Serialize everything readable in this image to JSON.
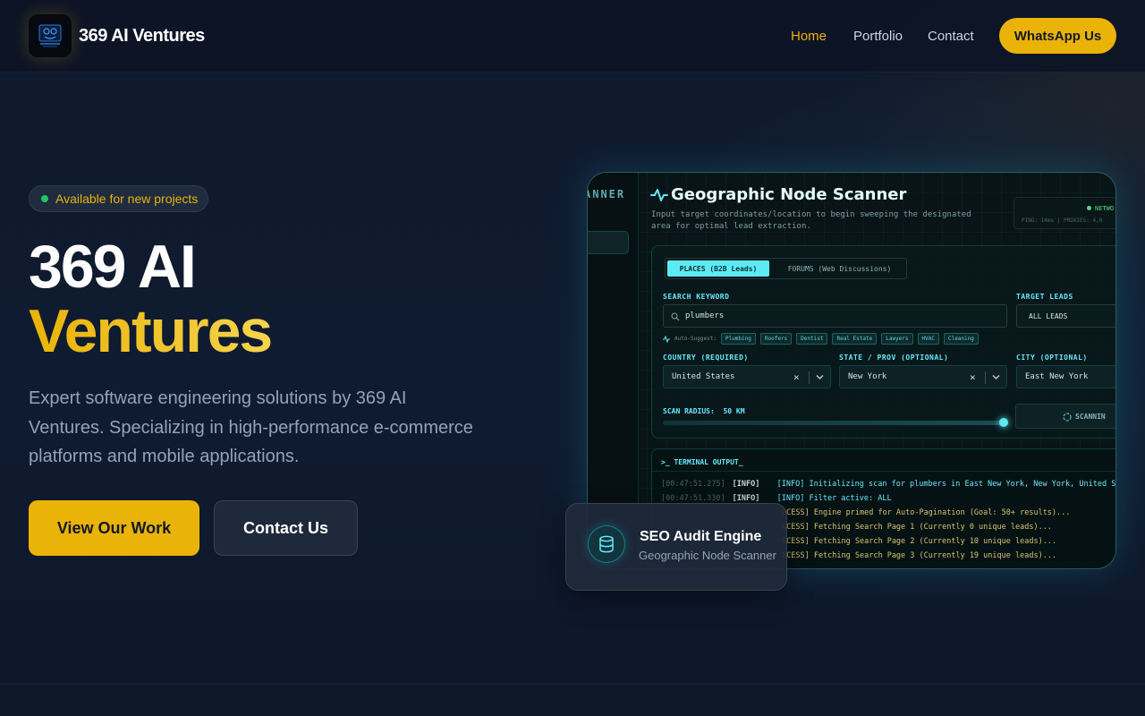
{
  "nav": {
    "brand": "369 AI Ventures",
    "links": [
      {
        "label": "Home",
        "active": true
      },
      {
        "label": "Portfolio",
        "active": false
      },
      {
        "label": "Contact",
        "active": false
      }
    ],
    "cta": "WhatsApp Us"
  },
  "hero": {
    "badge": "Available for new projects",
    "title_line1": "369 AI",
    "title_line2": "Ventures",
    "description": "Expert software engineering solutions by 369 AI Ventures. Specializing in high-performance e-commerce platforms and mobile applications.",
    "primary_button": "View Our Work",
    "secondary_button": "Contact Us"
  },
  "preview": {
    "sidebar_title": "ANNER",
    "title": "Geographic Node Scanner",
    "subtitle": "Input target coordinates/location to begin sweeping the designated area for optimal lead extraction.",
    "network_status": "NETWO",
    "network_stats": "PING: 14ms | PROXIES: 4,0",
    "tabs": [
      "PLACES (B2B Leads)",
      "FORUMS (Web Discussions)"
    ],
    "search_label": "SEARCH KEYWORD",
    "search_value": "plumbers",
    "target_label": "TARGET LEADS",
    "target_value": "ALL LEADS",
    "auto_suggest_label": "Auto-Suggest:",
    "suggestions": [
      "Plumbing",
      "Roofers",
      "Dentist",
      "Real Estate",
      "Lawyers",
      "HVAC",
      "Cleaning"
    ],
    "country_label": "COUNTRY (REQUIRED)",
    "country_value": "United States",
    "state_label": "STATE / PROV (OPTIONAL)",
    "state_value": "New York",
    "city_label": "CITY (OPTIONAL)",
    "city_value": "East New York",
    "radius_label": "SCAN RADIUS:",
    "radius_value": "50 KM",
    "radius_fraction": 1.0,
    "scan_button": "SCANNIN",
    "terminal_title": "TERMINAL OUTPUT_",
    "logs": [
      {
        "ts": "[00:47:51.275]",
        "lvl": "[INFO]",
        "msg": "[INFO] Initializing scan for plumbers in East New York, New York, United S"
      },
      {
        "ts": "[00:47:51.330]",
        "lvl": "[INFO]",
        "msg": "[INFO] Filter active: ALL"
      },
      {
        "ts": "",
        "lvl": "",
        "msg": "OCESS] Engine primed for Auto-Pagination (Goal: 50+ results)..."
      },
      {
        "ts": "",
        "lvl": "",
        "msg": "OCESS] Fetching Search Page 1 (Currently 0 unique leads)..."
      },
      {
        "ts": "",
        "lvl": "",
        "msg": "OCESS] Fetching Search Page 2 (Currently 10 unique leads)..."
      },
      {
        "ts": "",
        "lvl": "",
        "msg": "OCESS] Fetching Search Page 3 (Currently 19 unique leads)..."
      }
    ]
  },
  "floating_card": {
    "title": "SEO Audit Engine",
    "subtitle": "Geographic Node Scanner",
    "icon": "database-icon"
  },
  "colors": {
    "accent": "#eab308",
    "background": "#0f1729",
    "cyan": "#67e8f9",
    "status_green": "#22c55e"
  }
}
